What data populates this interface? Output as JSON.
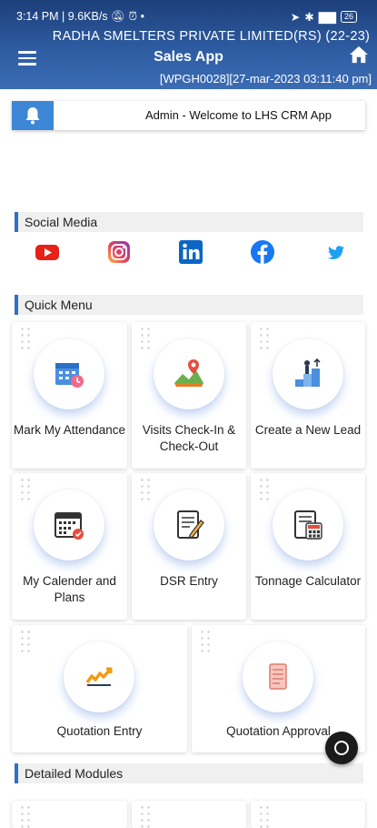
{
  "status_bar": {
    "time": "3:14 PM",
    "speed": "9.6KB/s",
    "battery": "26"
  },
  "header": {
    "company": "RADHA SMELTERS PRIVATE LIMITED(RS) (22-23)",
    "app_title": "Sales App",
    "session": "[WPGH0028][27-mar-2023 03:11:40 pm]"
  },
  "ticker": {
    "text": "Admin - Welcome to LHS CRM App"
  },
  "social": {
    "heading": "Social Media",
    "items": [
      "youtube-icon",
      "instagram-icon",
      "linkedin-icon",
      "facebook-icon",
      "twitter-icon"
    ]
  },
  "quick_menu": {
    "heading": "Quick Menu",
    "tiles": [
      {
        "label": "Mark My Attendance"
      },
      {
        "label": "Visits Check-In & Check-Out"
      },
      {
        "label": "Create a New Lead"
      },
      {
        "label": "My Calender and Plans"
      },
      {
        "label": "DSR Entry"
      },
      {
        "label": "Tonnage Calculator"
      },
      {
        "label": "Quotation Entry"
      },
      {
        "label": "Quotation Approval"
      }
    ]
  },
  "detailed": {
    "heading": "Detailed Modules"
  },
  "colors": {
    "header": "#2f5ea4",
    "accent": "#3e86d6",
    "section_bar": "#2f6fc8"
  }
}
